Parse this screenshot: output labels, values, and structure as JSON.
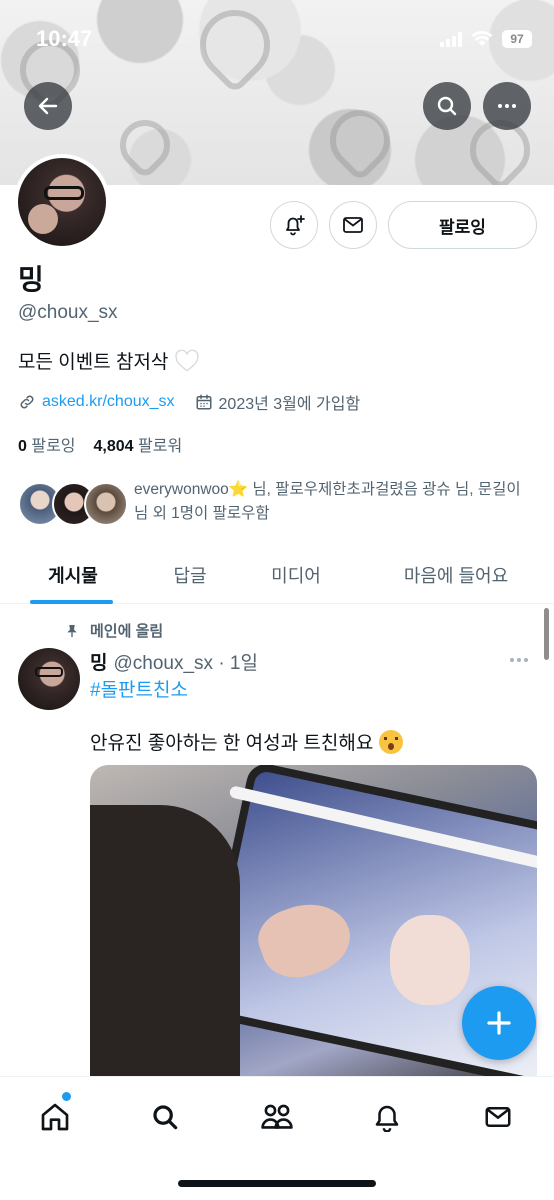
{
  "status_bar": {
    "time": "10:47",
    "battery": "97"
  },
  "profile": {
    "display_name": "밍",
    "handle": "@choux_sx",
    "bio": "모든 이벤트 참저삭",
    "link": "asked.kr/choux_sx",
    "joined": "2023년 3월에 가입함",
    "following_count": "0",
    "following_label": "팔로잉",
    "followers_count": "4,804",
    "followers_label": "팔로워",
    "followers_you_know": "everywonwoo⭐ 님, 팔로우제한초과걸렸음 광슈 님, 문길이 님 외 1명이 팔로우함"
  },
  "actions": {
    "following_button": "팔로잉"
  },
  "tabs": [
    {
      "label": "게시물",
      "active": true
    },
    {
      "label": "답글",
      "active": false
    },
    {
      "label": "미디어",
      "active": false
    },
    {
      "label": "마음에 들어요",
      "active": false
    }
  ],
  "post": {
    "pinned_label": "메인에 올림",
    "author_name": "밍",
    "author_meta": "@choux_sx · 1일",
    "hashtag": "#돌판트친소",
    "text": "안유진 좋아하는 한 여성과 트친해요"
  },
  "icons": {
    "back": "arrow-left-icon",
    "search": "search-icon",
    "more": "more-horizontal-icon",
    "notify": "bell-plus-icon",
    "message": "mail-icon",
    "link": "link-icon",
    "calendar": "calendar-icon",
    "pin": "pin-icon",
    "compose": "plus-icon"
  },
  "colors": {
    "accent": "#1d9bf0",
    "text": "#0f1419",
    "muted": "#536471"
  }
}
